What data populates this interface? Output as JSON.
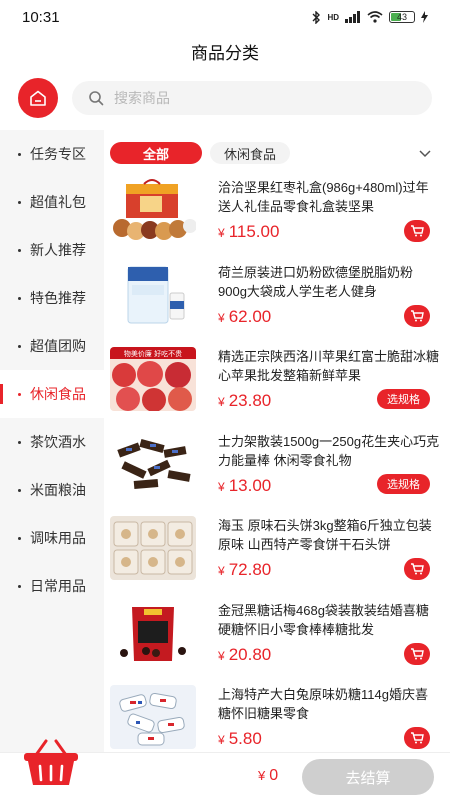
{
  "status": {
    "time": "10:31",
    "network": "HD",
    "battery": "43"
  },
  "header": {
    "title": "商品分类"
  },
  "search": {
    "placeholder": "搜索商品"
  },
  "sidebar": {
    "items": [
      {
        "label": "任务专区",
        "active": false
      },
      {
        "label": "超值礼包",
        "active": false
      },
      {
        "label": "新人推荐",
        "active": false
      },
      {
        "label": "特色推荐",
        "active": false
      },
      {
        "label": "超值团购",
        "active": false
      },
      {
        "label": "休闲食品",
        "active": true
      },
      {
        "label": "茶饮酒水",
        "active": false
      },
      {
        "label": "米面粮油",
        "active": false
      },
      {
        "label": "调味用品",
        "active": false
      },
      {
        "label": "日常用品",
        "active": false
      }
    ]
  },
  "filters": {
    "all": "全部",
    "sub": "休闲食品"
  },
  "currency": "¥",
  "products": [
    {
      "name": "洽洽坚果红枣礼盒(986g+480ml)过年送人礼佳品零食礼盒装坚果",
      "price": "115.00",
      "action": "cart"
    },
    {
      "name": "荷兰原装进口奶粉欧德堡脱脂奶粉900g大袋成人学生老人健身",
      "price": "62.00",
      "action": "cart"
    },
    {
      "name": "精选正宗陕西洛川苹果红富士脆甜冰糖心苹果批发整箱新鲜苹果",
      "price": "23.80",
      "action": "spec",
      "action_label": "选规格",
      "badge": "物美价廉 好吃不贵"
    },
    {
      "name": "士力架散装1500g一250g花生夹心巧克力能量棒 休闲零食礼物",
      "price": "13.00",
      "action": "spec",
      "action_label": "选规格"
    },
    {
      "name": "海玉 原味石头饼3kg整箱6斤独立包装原味 山西特产零食饼干石头饼",
      "price": "72.80",
      "action": "cart"
    },
    {
      "name": "金冠黑糖话梅468g袋装散装结婚喜糖硬糖怀旧小零食棒棒糖批发",
      "price": "20.80",
      "action": "cart"
    },
    {
      "name": "上海特产大白兔原味奶糖114g婚庆喜糖怀旧糖果零食",
      "price": "5.80",
      "action": "cart"
    }
  ],
  "bottom": {
    "total": "0",
    "checkout_label": "去结算"
  },
  "colors": {
    "accent": "#e8242a"
  }
}
